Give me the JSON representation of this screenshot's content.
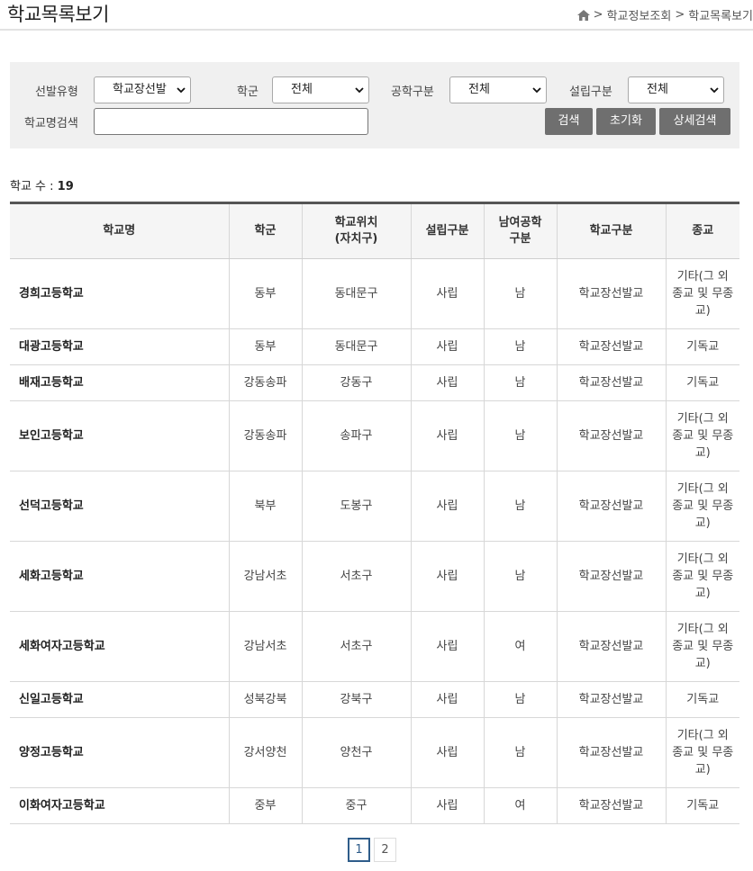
{
  "page": {
    "title": "학교목록보기",
    "breadcrumb": [
      ">",
      "학교정보조회",
      ">",
      "학교목록보기"
    ]
  },
  "filters": {
    "selection_type": {
      "label": "선발유형",
      "value": "학교장선발"
    },
    "school_district": {
      "label": "학군",
      "value": "전체"
    },
    "coed": {
      "label": "공학구분",
      "value": "전체"
    },
    "establishment": {
      "label": "설립구분",
      "value": "전체"
    },
    "school_name": {
      "label": "학교명검색",
      "value": ""
    },
    "buttons": {
      "search": "검색",
      "reset": "초기화",
      "detail_search": "상세검색"
    }
  },
  "summary": {
    "count_label": "학교 수 : ",
    "count_value": "19"
  },
  "table": {
    "headers": [
      "학교명",
      "학군",
      "학교위치\n(자치구)",
      "설립구분",
      "남여공학\n구분",
      "학교구분",
      "종교"
    ],
    "rows": [
      {
        "name": "경희고등학교",
        "district": "동부",
        "gu": "동대문구",
        "est": "사립",
        "coed": "남",
        "type": "학교장선발교",
        "religion": "기타(그 외 종교 및 무종교)"
      },
      {
        "name": "대광고등학교",
        "district": "동부",
        "gu": "동대문구",
        "est": "사립",
        "coed": "남",
        "type": "학교장선발교",
        "religion": "기독교"
      },
      {
        "name": "배재고등학교",
        "district": "강동송파",
        "gu": "강동구",
        "est": "사립",
        "coed": "남",
        "type": "학교장선발교",
        "religion": "기독교"
      },
      {
        "name": "보인고등학교",
        "district": "강동송파",
        "gu": "송파구",
        "est": "사립",
        "coed": "남",
        "type": "학교장선발교",
        "religion": "기타(그 외 종교 및 무종교)"
      },
      {
        "name": "선덕고등학교",
        "district": "북부",
        "gu": "도봉구",
        "est": "사립",
        "coed": "남",
        "type": "학교장선발교",
        "religion": "기타(그 외 종교 및 무종교)"
      },
      {
        "name": "세화고등학교",
        "district": "강남서초",
        "gu": "서초구",
        "est": "사립",
        "coed": "남",
        "type": "학교장선발교",
        "religion": "기타(그 외 종교 및 무종교)"
      },
      {
        "name": "세화여자고등학교",
        "district": "강남서초",
        "gu": "서초구",
        "est": "사립",
        "coed": "여",
        "type": "학교장선발교",
        "religion": "기타(그 외 종교 및 무종교)"
      },
      {
        "name": "신일고등학교",
        "district": "성북강북",
        "gu": "강북구",
        "est": "사립",
        "coed": "남",
        "type": "학교장선발교",
        "religion": "기독교"
      },
      {
        "name": "양정고등학교",
        "district": "강서양천",
        "gu": "양천구",
        "est": "사립",
        "coed": "남",
        "type": "학교장선발교",
        "religion": "기타(그 외 종교 및 무종교)"
      },
      {
        "name": "이화여자고등학교",
        "district": "중부",
        "gu": "중구",
        "est": "사립",
        "coed": "여",
        "type": "학교장선발교",
        "religion": "기독교"
      }
    ]
  },
  "pagination": {
    "pages": [
      "1",
      "2"
    ],
    "current": "1"
  },
  "colors": {
    "accent": "#2f5d8a",
    "button": "#6f6f6f",
    "filter_bg": "#f0f0f0"
  },
  "icons": {
    "home": "home-icon",
    "select_caret": "chevron-down-icon"
  }
}
